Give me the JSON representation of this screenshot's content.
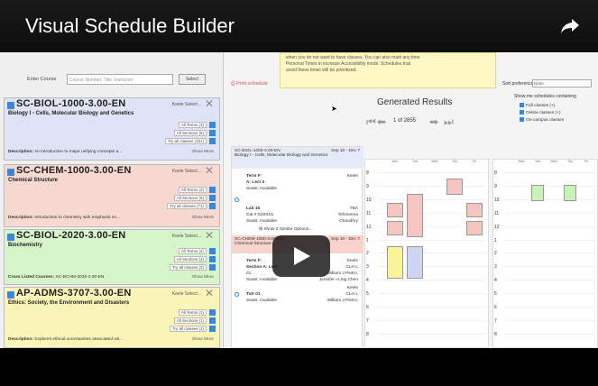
{
  "video": {
    "title": "Visual Schedule Builder"
  },
  "search": {
    "label": "Enter Course",
    "placeholder": "Course Number, Title, Instructor",
    "button": "Select"
  },
  "courses": [
    {
      "code": "SC-BIOL-1000-3.00-EN",
      "name": "Biology I - Cells, Molecular Biology and Genetics",
      "select": "Keele Select...",
      "options": [
        "All Terms (3)",
        "All Sections (6)",
        "Try all classes (101)"
      ],
      "footer_label": "Description:",
      "footer": "An introduction to major unifying concepts a...",
      "more": "Show More",
      "color": "#dfe3f5"
    },
    {
      "code": "SC-CHEM-1000-3.00-EN",
      "name": "Chemical Structure",
      "select": "Keele Select...",
      "options": [
        "All Terms (2)",
        "All Sections (5)",
        "Try all classes (71)"
      ],
      "footer_label": "Description:",
      "footer": "Introduction to chemistry with emphasis on...",
      "more": "Show More",
      "color": "#f7d9d2"
    },
    {
      "code": "SC-BIOL-2020-3.00-EN",
      "name": "Biochemistry",
      "select": "Keele Select...",
      "options": [
        "All Terms (2)",
        "All Sections (2)",
        "Try all classes (2)"
      ],
      "footer_label": "Cross Listed Courses:",
      "footer": "SC-BCHM-2020-3.00-EN",
      "more": "Show More",
      "color": "#d6f6c9"
    },
    {
      "code": "AP-ADMS-3707-3.00-EN",
      "name": "Ethics: Society, the Environment and Disasters",
      "select": "Keele Select...",
      "options": [
        "All Terms (1)",
        "All Sections (1)",
        "Try all classes (1)"
      ],
      "footer_label": "Description:",
      "footer": "Explores ethical uncertainties associated wit...",
      "more": "Show More",
      "color": "#fbf6b8"
    }
  ],
  "notice": {
    "line1": "when you do not want to have classes. You can also mark any time",
    "line2": "Personal Times in increase Accessibility mode. Schedules that",
    "line3": "avoid these times will be prioritized."
  },
  "results": {
    "print": "Print schedule",
    "title": "Generated Results",
    "page": "1 of 2855",
    "sort_label": "Sort preference:",
    "sort_value": "None",
    "show_me": "Show me schedules containing",
    "checks": [
      "Full classes (+)",
      "Online classes (+)",
      "On-campus classes"
    ]
  },
  "details": {
    "c1_head": "SC-BIOL-1000-3.00-EN",
    "c1_dates": "Sep 10 - Dec 7",
    "c1_name": "Biology I - Cells, Molecular Biology and Genetics",
    "term": "Term F:",
    "term_place": "Keele",
    "lect": "A: Lect 0",
    "seats": "Seats: Available",
    "lab": "Lab 15",
    "cat": "Cat #:S20X15",
    "lab_loc": "TBA",
    "lab_instr": "Tehmeena",
    "lab_instr2": "Chaudhry",
    "similar": "Show 2 Similar Options...",
    "c2_head": "SC-CHEM-1000-3.00-EN",
    "c2_dates": "Sep 10 - Dec 7",
    "c2_name": "Chemical Structure",
    "c2_term": "Term F:",
    "c2_place": "Keele",
    "c2_sect": "Section A: Lect",
    "c2_room": "CLH L",
    "c2_num": "01",
    "c2_instr": "William J Pietro,",
    "c2_seats": "Seats: Available",
    "c2_instr2": "Jennifer I-Ling Chen",
    "c2_place2": "Keele",
    "tutr": "Tutr 01",
    "tutr_room": "CLH L",
    "tutr_seats": "Seats: Available",
    "tutr_instr": "William J Pietro,"
  },
  "calendar": {
    "days": [
      "Mon",
      "Tue",
      "Wed",
      "Thu",
      "Fri"
    ],
    "hours": [
      "8",
      "9",
      "10",
      "11",
      "12",
      "1",
      "2",
      "3",
      "4",
      "5",
      "6",
      "7",
      "8"
    ],
    "hours2": [
      "8",
      "9",
      "10",
      "11",
      "12",
      "1",
      "2",
      "3",
      "4",
      "5",
      "6",
      "7",
      "8"
    ]
  }
}
